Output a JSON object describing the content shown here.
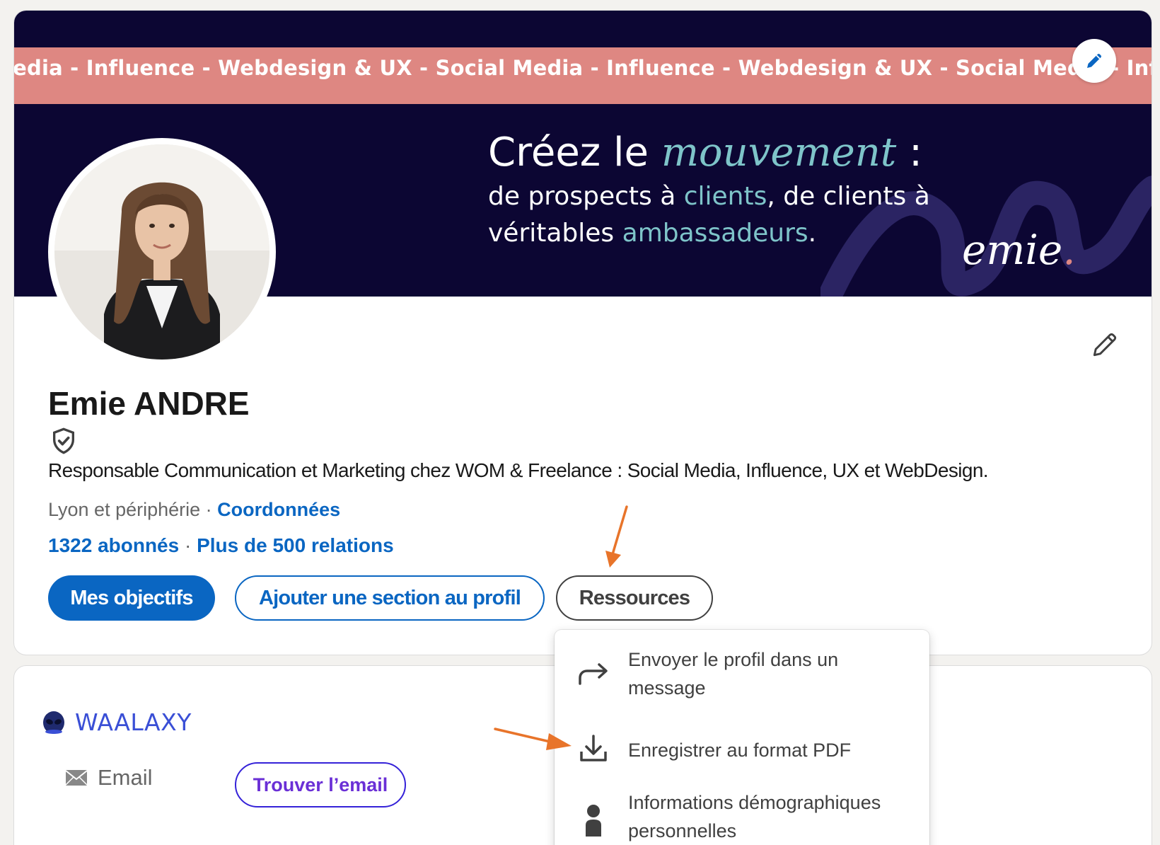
{
  "banner": {
    "ticker": "ledia - Influence - Webdesign & UX - Social Media - Influence - Webdesign & UX - Social Media - Influence - We",
    "headline_prefix": "Créez le ",
    "headline_accent": "mouvement",
    "headline_suffix": " :",
    "line1_prefix": "de prospects à ",
    "line1_accent": "clients",
    "line1_suffix": ", de clients à",
    "line2_prefix": "véritables ",
    "line2_accent": "ambassadeurs",
    "line2_suffix": ".",
    "logo": "emie",
    "logo_dot": ".",
    "accent_color": "#7ec4c9",
    "background_color": "#0c0633",
    "ticker_color": "#de8782"
  },
  "profile": {
    "name": "Emie ANDRE",
    "headline": "Responsable Communication et Marketing chez WOM & Freelance : Social Media, Influence, UX et WebDesign.",
    "location": "Lyon et périphérie",
    "location_sep": " · ",
    "contact_link": "Coordonnées",
    "followers": "1322 abonnés",
    "stats_sep": " · ",
    "connections": "Plus de 500 relations"
  },
  "actions": {
    "goals": "Mes objectifs",
    "add_section": "Ajouter une section au profil",
    "resources": "Ressources"
  },
  "resources_menu": {
    "send": "Envoyer le profil dans un message",
    "pdf": "Enregistrer au format PDF",
    "demographics": "Informations démographiques personnelles"
  },
  "waalaxy": {
    "name": "WAALAXY",
    "email_label": "Email",
    "find_email": "Trouver l’email"
  },
  "icons": {
    "banner_edit": "pencil-icon",
    "profile_edit": "pencil-icon",
    "verified": "shield-check-icon",
    "send": "share-arrow-icon",
    "pdf": "download-icon",
    "demographics": "person-icon",
    "email": "envelope-icon",
    "waalaxy": "alien-icon"
  },
  "colors": {
    "link": "#0a66c2",
    "annotation_arrow": "#e8742a"
  }
}
